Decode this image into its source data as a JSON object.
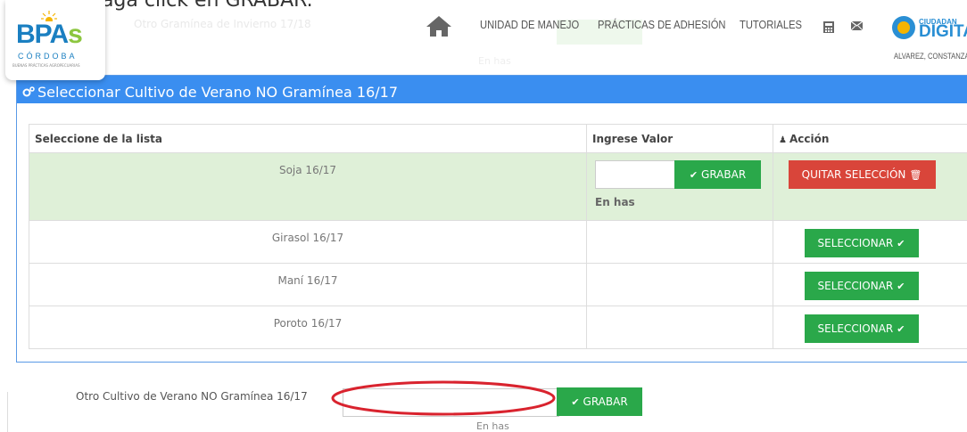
{
  "instruction_text": "haga click en GRABAR.",
  "ghost": {
    "row_label": "Otro Gramínea de Invierno 17/18",
    "enhas": "En has"
  },
  "logo": {
    "bpa": "BPA",
    "s": "s",
    "cordoba": "CÓRDOBA",
    "tagline": "BUENAS PRÁCTICAS AGROPECUARIAS"
  },
  "nav": {
    "home_icon": "home-icon",
    "items": [
      "UNIDAD DE MANEJO",
      "PRÁCTICAS DE ADHESIÓN",
      "TUTORIALES"
    ],
    "calculator_icon": "calculator-icon",
    "mail_icon": "envelope-icon",
    "ciudadano_small": "CIUDADAN",
    "ciudadano_big": "DIGITA",
    "user": "ALVAREZ, CONSTANZA"
  },
  "panel": {
    "title": "Seleccionar Cultivo de Verano NO Gramínea 16/17",
    "header_color": "#3a8ef0"
  },
  "table": {
    "headers": [
      "Seleccione de la lista",
      "Ingrese Valor",
      "Acción"
    ],
    "rows": [
      {
        "name": "Soja 16/17",
        "selected": true,
        "unit": "En has",
        "grabar_label": "GRABAR",
        "action_label": "QUITAR SELECCIÓN"
      },
      {
        "name": "Girasol 16/17",
        "selected": false,
        "action_label": "SELECCIONAR"
      },
      {
        "name": "Maní 16/17",
        "selected": false,
        "action_label": "SELECCIONAR"
      },
      {
        "name": "Poroto 16/17",
        "selected": false,
        "action_label": "SELECCIONAR"
      }
    ]
  },
  "other": {
    "label": "Otro Cultivo de Verano NO Gramínea 16/17",
    "grabar_label": "GRABAR",
    "unit": "En has"
  },
  "colors": {
    "green": "#2aa84a",
    "red": "#d9453a",
    "selected_row": "#dff0d8",
    "annotation": "#d9232e"
  }
}
